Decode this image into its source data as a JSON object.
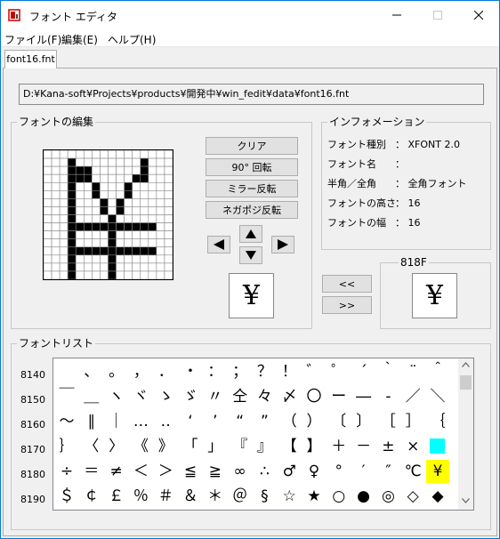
{
  "window": {
    "title": "フォント エディタ",
    "minimize_icon": "minimize-icon",
    "maximize_icon": "maximize-icon",
    "close_icon": "close-icon"
  },
  "menu": [
    "ファイル(F)",
    "編集(E)",
    "ヘルプ(H)"
  ],
  "tab": "font16.fnt",
  "file_path": "D:¥Kana-soft¥Projects¥products¥開発中¥win_fedit¥data¥font16.fnt",
  "editor": {
    "title": "フォントの編集",
    "buttons": {
      "clear": "クリア",
      "rotate": "90° 回転",
      "mirror": "ミラー反転",
      "invert": "ネガポジ反転"
    },
    "arrows": [
      "arrow-left-icon",
      "arrow-up-icon",
      "arrow-down-icon",
      "arrow-right-icon"
    ],
    "preview_glyph": "¥",
    "grid_size": 16,
    "filled_pixels": [
      [
        3,
        1
      ],
      [
        3,
        2
      ],
      [
        3,
        3
      ],
      [
        3,
        4
      ],
      [
        3,
        5
      ],
      [
        3,
        6
      ],
      [
        3,
        7
      ],
      [
        3,
        8
      ],
      [
        3,
        9
      ],
      [
        3,
        10
      ],
      [
        3,
        11
      ],
      [
        3,
        12
      ],
      [
        3,
        13
      ],
      [
        3,
        14
      ],
      [
        3,
        15
      ],
      [
        4,
        2
      ],
      [
        5,
        2
      ],
      [
        4,
        3
      ],
      [
        5,
        3
      ],
      [
        6,
        4
      ],
      [
        6,
        5
      ],
      [
        7,
        6
      ],
      [
        7,
        7
      ],
      [
        8,
        8
      ],
      [
        12,
        1
      ],
      [
        12,
        2
      ],
      [
        11,
        3
      ],
      [
        12,
        3
      ],
      [
        10,
        4
      ],
      [
        10,
        5
      ],
      [
        9,
        6
      ],
      [
        9,
        7
      ],
      [
        8,
        8
      ],
      [
        3,
        9
      ],
      [
        4,
        9
      ],
      [
        5,
        9
      ],
      [
        6,
        9
      ],
      [
        7,
        9
      ],
      [
        8,
        9
      ],
      [
        9,
        9
      ],
      [
        10,
        9
      ],
      [
        11,
        9
      ],
      [
        12,
        9
      ],
      [
        13,
        9
      ],
      [
        8,
        10
      ],
      [
        8,
        11
      ],
      [
        3,
        12
      ],
      [
        4,
        12
      ],
      [
        5,
        12
      ],
      [
        6,
        12
      ],
      [
        7,
        12
      ],
      [
        8,
        12
      ],
      [
        9,
        12
      ],
      [
        10,
        12
      ],
      [
        11,
        12
      ],
      [
        12,
        12
      ],
      [
        13,
        12
      ],
      [
        8,
        13
      ],
      [
        8,
        14
      ],
      [
        8,
        15
      ]
    ]
  },
  "info": {
    "title": "インフォメーション",
    "rows": [
      {
        "label": "フォント種別",
        "value": "： XFONT 2.0"
      },
      {
        "label": "フォント名",
        "value": "："
      },
      {
        "label": "半角／全角",
        "value": "： 全角フォント"
      },
      {
        "label": "フォントの高さ",
        "value": "： 16"
      },
      {
        "label": "フォントの幅",
        "value": "： 16"
      }
    ]
  },
  "transfer": {
    "to_editor": "<<",
    "to_list": ">>"
  },
  "code_box": {
    "title": "818F",
    "glyph": "¥"
  },
  "font_list": {
    "title": "フォントリスト",
    "rows": [
      {
        "code": "8140",
        "chars": [
          "　",
          "、",
          "。",
          "，",
          "．",
          "・",
          "：",
          "；",
          "？",
          "！",
          "゛",
          "゜",
          "´",
          "｀",
          "¨",
          "＾"
        ]
      },
      {
        "code": "8150",
        "chars": [
          "￣",
          "＿",
          "ヽ",
          "ヾ",
          "ゝ",
          "ゞ",
          "〃",
          "仝",
          "々",
          "〆",
          "〇",
          "ー",
          "―",
          "‐",
          "／",
          "＼"
        ]
      },
      {
        "code": "8160",
        "chars": [
          "～",
          "∥",
          "｜",
          "…",
          "‥",
          "‘",
          "’",
          "“",
          "”",
          "（",
          "）",
          "〔",
          "〕",
          "［",
          "］",
          "｛"
        ]
      },
      {
        "code": "8170",
        "chars": [
          "｝",
          "〈",
          "〉",
          "《",
          "》",
          "「",
          "」",
          "『",
          "』",
          "【",
          "】",
          "＋",
          "－",
          "±",
          "×",
          ""
        ]
      },
      {
        "code": "8180",
        "chars": [
          "÷",
          "＝",
          "≠",
          "＜",
          "＞",
          "≦",
          "≧",
          "∞",
          "∴",
          "♂",
          "♀",
          "°",
          "′",
          "″",
          "℃",
          "¥"
        ]
      },
      {
        "code": "8190",
        "chars": [
          "＄",
          "￠",
          "￡",
          "％",
          "＃",
          "＆",
          "＊",
          "＠",
          "§",
          "☆",
          "★",
          "○",
          "●",
          "◎",
          "◇",
          "◆"
        ]
      }
    ],
    "highlight": {
      "row": 3,
      "col": 15,
      "color": "#00ffff"
    },
    "selected": {
      "row": 4,
      "col": 15,
      "color": "#ffff00"
    }
  },
  "colors": {
    "titlebar_bg": "#ffffff",
    "window_border": "#0078d7",
    "selection_yellow": "#ffff00",
    "highlight_cyan": "#00ffff"
  }
}
